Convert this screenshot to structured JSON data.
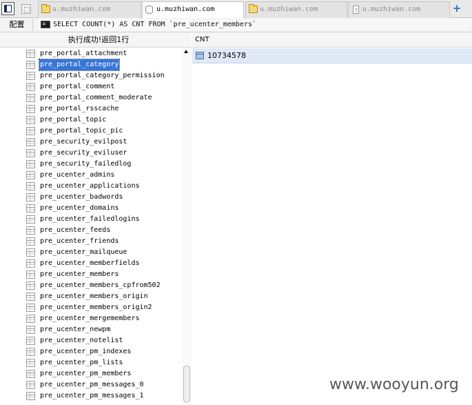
{
  "tabs": [
    {
      "label": "u.muzhiwan.com",
      "icon": "folder-icon",
      "active": false
    },
    {
      "label": "u.muzhiwan.com",
      "icon": "database-icon",
      "active": true
    },
    {
      "label": "u.muzhiwan.com",
      "icon": "folder-icon",
      "active": false
    },
    {
      "label": "u.muzhiwan.com",
      "icon": "document-icon",
      "active": false
    }
  ],
  "toolbar": {
    "config_label": "配置",
    "query": "SELECT COUNT(*) AS CNT FROM `pre_ucenter_members`"
  },
  "status": {
    "message": "执行成功!返回1行"
  },
  "table_list": [
    "pre_portal_attachment",
    "pre_portal_category",
    "pre_portal_category_permission",
    "pre_portal_comment",
    "pre_portal_comment_moderate",
    "pre_portal_rsscache",
    "pre_portal_topic",
    "pre_portal_topic_pic",
    "pre_security_evilpost",
    "pre_security_eviluser",
    "pre_security_failedlog",
    "pre_ucenter_admins",
    "pre_ucenter_applications",
    "pre_ucenter_badwords",
    "pre_ucenter_domains",
    "pre_ucenter_failedlogins",
    "pre_ucenter_feeds",
    "pre_ucenter_friends",
    "pre_ucenter_mailqueue",
    "pre_ucenter_memberfields",
    "pre_ucenter_members",
    "pre_ucenter_members_cpfrom502",
    "pre_ucenter_members_origin",
    "pre_ucenter_members_origin2",
    "pre_ucenter_mergemembers",
    "pre_ucenter_newpm",
    "pre_ucenter_notelist",
    "pre_ucenter_pm_indexes",
    "pre_ucenter_pm_lists",
    "pre_ucenter_pm_members",
    "pre_ucenter_pm_messages_0",
    "pre_ucenter_pm_messages_1"
  ],
  "selected_table": "pre_portal_category",
  "result": {
    "column": "CNT",
    "value": "10734578"
  },
  "watermark": "www.wooyun.org",
  "colors": {
    "selection": "#3875d7",
    "result_row": "#dfe9f7",
    "accent": "#2a6bb8"
  }
}
